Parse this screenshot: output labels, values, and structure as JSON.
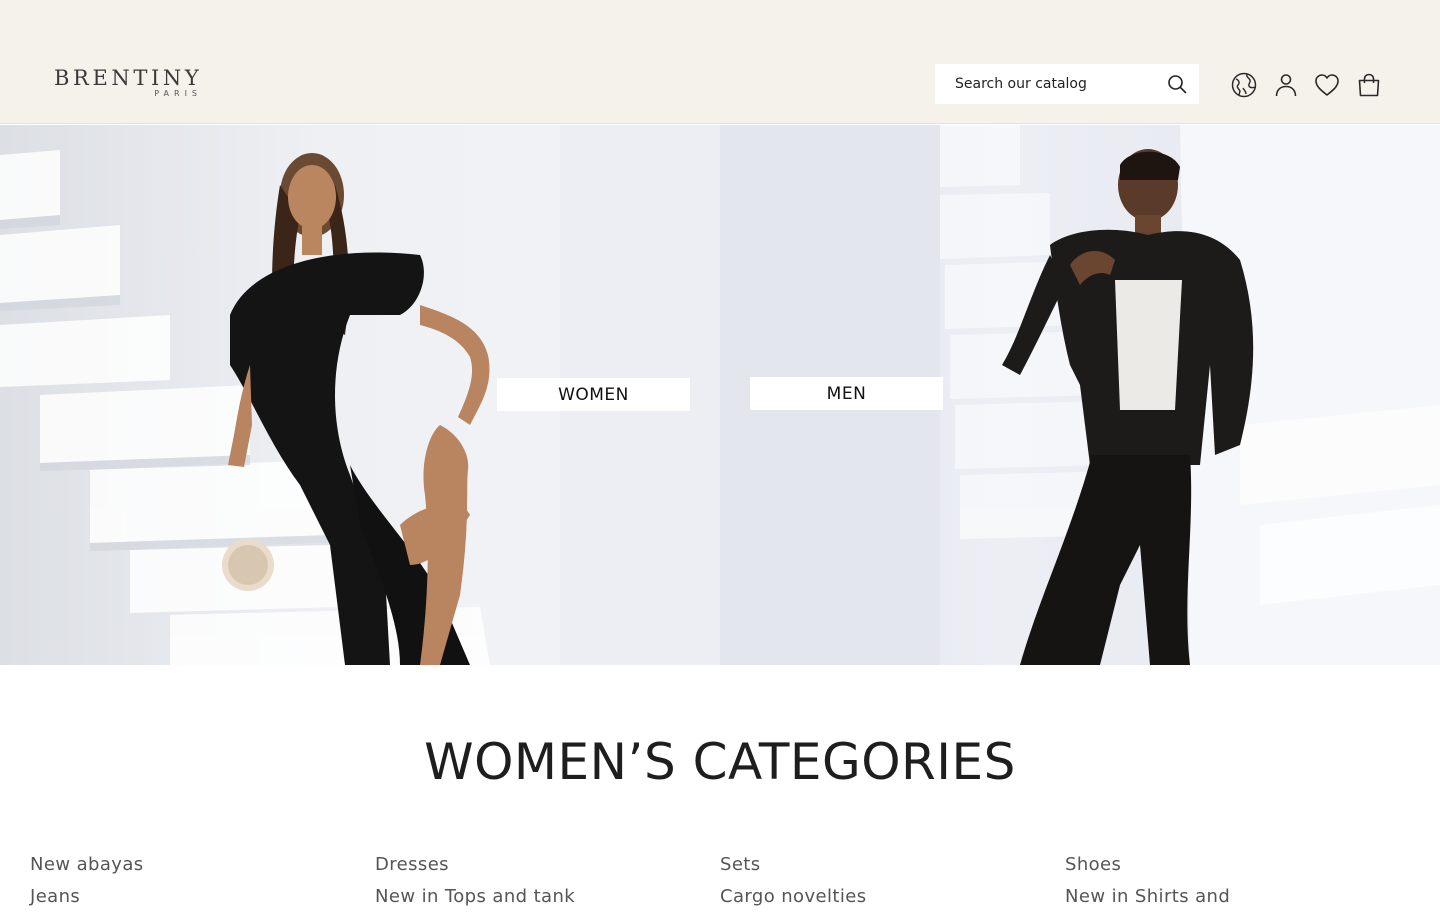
{
  "header": {
    "logo_main": "BRENTINY",
    "logo_sub": "PARIS",
    "search_placeholder": "Search our catalog",
    "icons": [
      "globe-icon",
      "user-icon",
      "heart-icon",
      "bag-icon"
    ]
  },
  "hero": {
    "women_label": "WOMEN",
    "men_label": "MEN"
  },
  "categories": {
    "title": "WOMEN’S CATEGORIES",
    "columns": [
      [
        "New abayas",
        "Jeans"
      ],
      [
        "Dresses",
        "New in Tops and tank"
      ],
      [
        "Sets",
        "Cargo novelties"
      ],
      [
        "Shoes",
        "New in Shirts and"
      ]
    ]
  },
  "colors": {
    "header_bg": "#f5f2ec",
    "text": "#1f1f1f",
    "link": "#555555"
  }
}
